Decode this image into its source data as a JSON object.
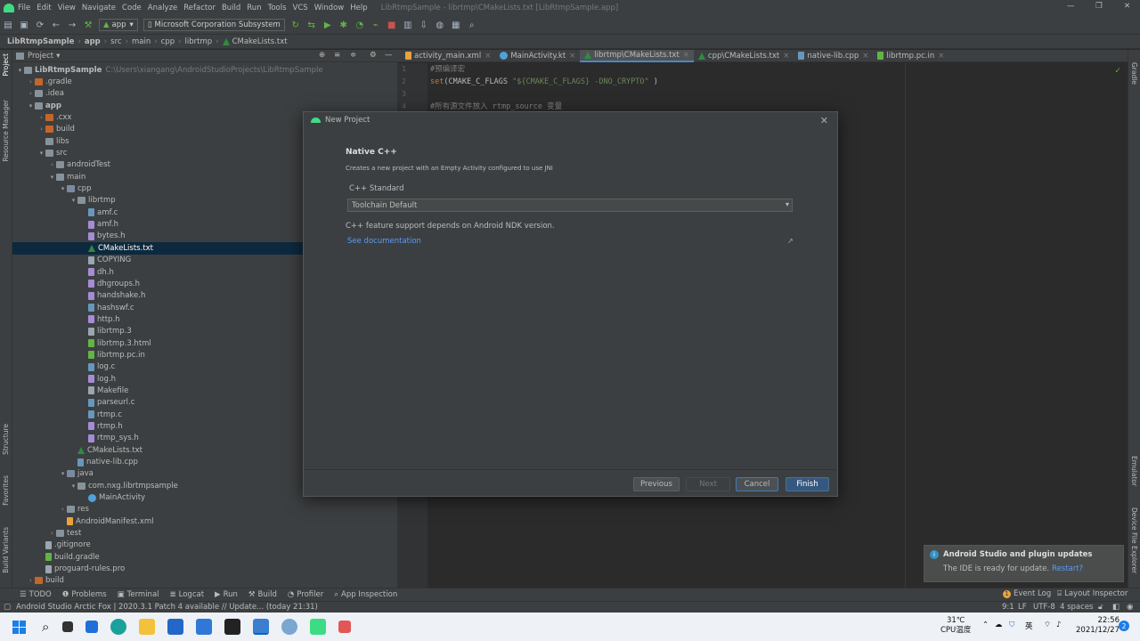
{
  "menubar": {
    "items": [
      "File",
      "Edit",
      "View",
      "Navigate",
      "Code",
      "Analyze",
      "Refactor",
      "Build",
      "Run",
      "Tools",
      "VCS",
      "Window",
      "Help"
    ],
    "window_title": "LibRtmpSample - librtmp\\CMakeLists.txt [LibRtmpSample.app]"
  },
  "toolbar": {
    "run_config": "app",
    "device": "Microsoft Corporation Subsystem"
  },
  "breadcrumb": [
    "LibRtmpSample",
    "app",
    "src",
    "main",
    "cpp",
    "librtmp",
    "CMakeLists.txt"
  ],
  "left_strip": [
    "Project",
    "Resource Manager",
    "Structure",
    "Favorites",
    "Build Variants"
  ],
  "right_strip": [
    "Gradle",
    "Emulator",
    "Device File Explorer"
  ],
  "project_panel": {
    "header": "Project",
    "tree": [
      {
        "label": "LibRtmpSample",
        "hint": "C:\\Users\\xiangang\\AndroidStudioProjects\\LibRtmpSample",
        "depth": 0,
        "icon": "folder",
        "arrow": "down",
        "bold": true
      },
      {
        "label": ".gradle",
        "depth": 1,
        "icon": "orange",
        "arrow": "right"
      },
      {
        "label": ".idea",
        "depth": 1,
        "icon": "folder",
        "arrow": "right"
      },
      {
        "label": "app",
        "depth": 1,
        "icon": "folder",
        "arrow": "down",
        "bold": true
      },
      {
        "label": ".cxx",
        "depth": 2,
        "icon": "orange",
        "arrow": "right"
      },
      {
        "label": "build",
        "depth": 2,
        "icon": "orange",
        "arrow": "right"
      },
      {
        "label": "libs",
        "depth": 2,
        "icon": "folder",
        "arrow": ""
      },
      {
        "label": "src",
        "depth": 2,
        "icon": "folder",
        "arrow": "down"
      },
      {
        "label": "androidTest",
        "depth": 3,
        "icon": "folder",
        "arrow": "right"
      },
      {
        "label": "main",
        "depth": 3,
        "icon": "folder",
        "arrow": "down"
      },
      {
        "label": "cpp",
        "depth": 4,
        "icon": "src",
        "arrow": "down"
      },
      {
        "label": "librtmp",
        "depth": 5,
        "icon": "folder",
        "arrow": "down"
      },
      {
        "label": "amf.c",
        "depth": 6,
        "icon": "c",
        "arrow": ""
      },
      {
        "label": "amf.h",
        "depth": 6,
        "icon": "h",
        "arrow": ""
      },
      {
        "label": "bytes.h",
        "depth": 6,
        "icon": "h",
        "arrow": ""
      },
      {
        "label": "CMakeLists.txt",
        "depth": 6,
        "icon": "tri",
        "arrow": "",
        "selected": true
      },
      {
        "label": "COPYING",
        "depth": 6,
        "icon": "file",
        "arrow": ""
      },
      {
        "label": "dh.h",
        "depth": 6,
        "icon": "h",
        "arrow": ""
      },
      {
        "label": "dhgroups.h",
        "depth": 6,
        "icon": "h",
        "arrow": ""
      },
      {
        "label": "handshake.h",
        "depth": 6,
        "icon": "h",
        "arrow": ""
      },
      {
        "label": "hashswf.c",
        "depth": 6,
        "icon": "c",
        "arrow": ""
      },
      {
        "label": "http.h",
        "depth": 6,
        "icon": "h",
        "arrow": ""
      },
      {
        "label": "librtmp.3",
        "depth": 6,
        "icon": "file",
        "arrow": ""
      },
      {
        "label": "librtmp.3.html",
        "depth": 6,
        "icon": "pc",
        "arrow": ""
      },
      {
        "label": "librtmp.pc.in",
        "depth": 6,
        "icon": "pc",
        "arrow": ""
      },
      {
        "label": "log.c",
        "depth": 6,
        "icon": "c",
        "arrow": ""
      },
      {
        "label": "log.h",
        "depth": 6,
        "icon": "h",
        "arrow": ""
      },
      {
        "label": "Makefile",
        "depth": 6,
        "icon": "file",
        "arrow": ""
      },
      {
        "label": "parseurl.c",
        "depth": 6,
        "icon": "c",
        "arrow": ""
      },
      {
        "label": "rtmp.c",
        "depth": 6,
        "icon": "c",
        "arrow": ""
      },
      {
        "label": "rtmp.h",
        "depth": 6,
        "icon": "h",
        "arrow": ""
      },
      {
        "label": "rtmp_sys.h",
        "depth": 6,
        "icon": "h",
        "arrow": ""
      },
      {
        "label": "CMakeLists.txt",
        "depth": 5,
        "icon": "tri",
        "arrow": ""
      },
      {
        "label": "native-lib.cpp",
        "depth": 5,
        "icon": "c",
        "arrow": ""
      },
      {
        "label": "java",
        "depth": 4,
        "icon": "src",
        "arrow": "down"
      },
      {
        "label": "com.nxg.librtmpsample",
        "depth": 5,
        "icon": "folder",
        "arrow": "down"
      },
      {
        "label": "MainActivity",
        "depth": 6,
        "icon": "kt",
        "arrow": ""
      },
      {
        "label": "res",
        "depth": 4,
        "icon": "folder",
        "arrow": "right"
      },
      {
        "label": "AndroidManifest.xml",
        "depth": 4,
        "icon": "xml",
        "arrow": ""
      },
      {
        "label": "test",
        "depth": 3,
        "icon": "folder",
        "arrow": "right"
      },
      {
        "label": ".gitignore",
        "depth": 2,
        "icon": "file",
        "arrow": ""
      },
      {
        "label": "build.gradle",
        "depth": 2,
        "icon": "pc",
        "arrow": ""
      },
      {
        "label": "proguard-rules.pro",
        "depth": 2,
        "icon": "file",
        "arrow": ""
      },
      {
        "label": "build",
        "depth": 1,
        "icon": "orange",
        "arrow": "right"
      }
    ]
  },
  "editor": {
    "tabs": [
      {
        "label": "activity_main.xml",
        "icon": "xml"
      },
      {
        "label": "MainActivity.kt",
        "icon": "kt"
      },
      {
        "label": "librtmp\\CMakeLists.txt",
        "icon": "tri",
        "active": true
      },
      {
        "label": "cpp\\CMakeLists.txt",
        "icon": "tri"
      },
      {
        "label": "native-lib.cpp",
        "icon": "c"
      },
      {
        "label": "librtmp.pc.in",
        "icon": "pc"
      }
    ],
    "line_numbers": [
      "1",
      "2",
      "3",
      "4"
    ],
    "code": {
      "l1": "#预编译宏",
      "l2_kw": "set",
      "l2_a": "(CMAKE_C_FLAGS ",
      "l2_s": "\"${CMAKE_C_FLAGS} -DNO_CRYPTO\"",
      "l2_b": " )",
      "l4": "#所有源文件放入 rtmp_source 变量"
    }
  },
  "dialog": {
    "title": "New Project",
    "heading": "Native C++",
    "subtitle": "Creates a new project with an Empty Activity configured to use JNI",
    "cpp_standard_label": "C++ Standard",
    "cpp_standard_value": "Toolchain Default",
    "ndk_note": "C++ feature support depends on Android NDK version.",
    "doc_link": "See documentation",
    "buttons": {
      "previous": "Previous",
      "next": "Next",
      "cancel": "Cancel",
      "finish": "Finish"
    }
  },
  "notification": {
    "title": "Android Studio and plugin updates",
    "text": "The IDE is ready for update.",
    "link": "Restart?"
  },
  "bottom_tools": [
    "TODO",
    "Problems",
    "Terminal",
    "Logcat",
    "Run",
    "Build",
    "Profiler",
    "App Inspection"
  ],
  "bottom_right_tools": [
    "Event Log",
    "Layout Inspector"
  ],
  "event_log_count": "1",
  "status": {
    "message": "Android Studio Arctic Fox | 2020.3.1 Patch 4 available // Update... (today 21:31)",
    "position": "9:1",
    "line_sep": "LF",
    "encoding": "UTF-8",
    "indent": "4 spaces"
  },
  "taskbar": {
    "temp": "31℃",
    "temp_label": "CPU温度",
    "ime": "英",
    "time": "22:56",
    "date": "2021/12/27",
    "badge": "2"
  }
}
